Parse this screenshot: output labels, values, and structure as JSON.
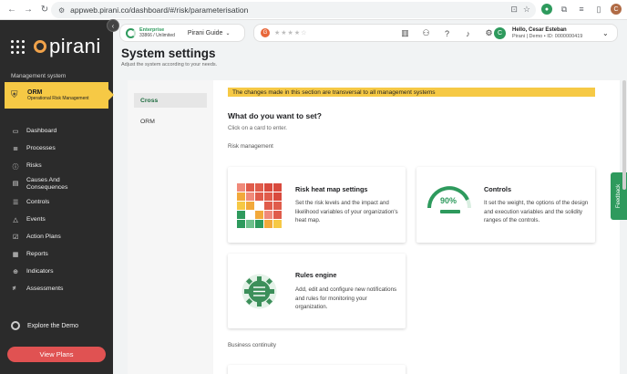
{
  "browser": {
    "url": "appweb.pirani.co/dashboard/#/risk/parameterisation",
    "nav_back": "←",
    "nav_forward": "→",
    "nav_reload": "↻",
    "avatar_letter": "C"
  },
  "sidebar": {
    "brand": "pirani",
    "section_label": "Management system",
    "module": {
      "title": "ORM",
      "subtitle": "Operational Risk Management"
    },
    "items": [
      {
        "label": "Dashboard",
        "icon": "monitor-icon"
      },
      {
        "label": "Processes",
        "icon": "layers-icon"
      },
      {
        "label": "Risks",
        "icon": "alert-circle-icon"
      },
      {
        "label": "Causes And Consequences",
        "icon": "causes-icon"
      },
      {
        "label": "Controls",
        "icon": "sliders-icon"
      },
      {
        "label": "Events",
        "icon": "warning-triangle-icon"
      },
      {
        "label": "Action Plans",
        "icon": "checklist-icon"
      },
      {
        "label": "Reports",
        "icon": "reports-icon"
      },
      {
        "label": "Indicators",
        "icon": "crosshair-icon"
      },
      {
        "label": "Assessments",
        "icon": "assessment-icon"
      }
    ],
    "explore_label": "Explore the Demo",
    "view_plans_label": "View Plans"
  },
  "header": {
    "plan_name": "Enterprise",
    "plan_usage": "33866 / Unlimited",
    "guide_label": "Pirani Guide",
    "user_avatar": "C",
    "user_greeting": "Hello, Cesar Esteban",
    "user_details": "Pirani | Demo • ID: 0000000419"
  },
  "page": {
    "title": "System settings",
    "subtitle": "Adjust the system according to your needs.",
    "tabs": [
      {
        "label": "Cross",
        "active": true
      },
      {
        "label": "ORM",
        "active": false
      }
    ],
    "notice": "The changes made in this section are transversal to all management systems",
    "question": "What do you want to set?",
    "hint": "Click on a card to enter.",
    "section_risk": "Risk management",
    "section_continuity": "Business continuity",
    "cards": {
      "heatmap": {
        "title": "Risk heat map settings",
        "description": "Set the risk levels and the impact and likelihood variables of your organization's heat map."
      },
      "controls": {
        "title": "Controls",
        "description": "It set the weight, the options of the design and execution variables and the solidity ranges of the controls.",
        "gauge_value": "90%"
      },
      "rules": {
        "title": "Rules engine",
        "description": "Add, edit and configure new notifications and rules for monitoring your organization."
      }
    }
  },
  "feedback_label": "Feedback",
  "colors": {
    "accent_green": "#2e9a5d",
    "accent_yellow": "#f6c945",
    "danger_red": "#e05252",
    "sidebar_bg": "#2b2b2b"
  }
}
